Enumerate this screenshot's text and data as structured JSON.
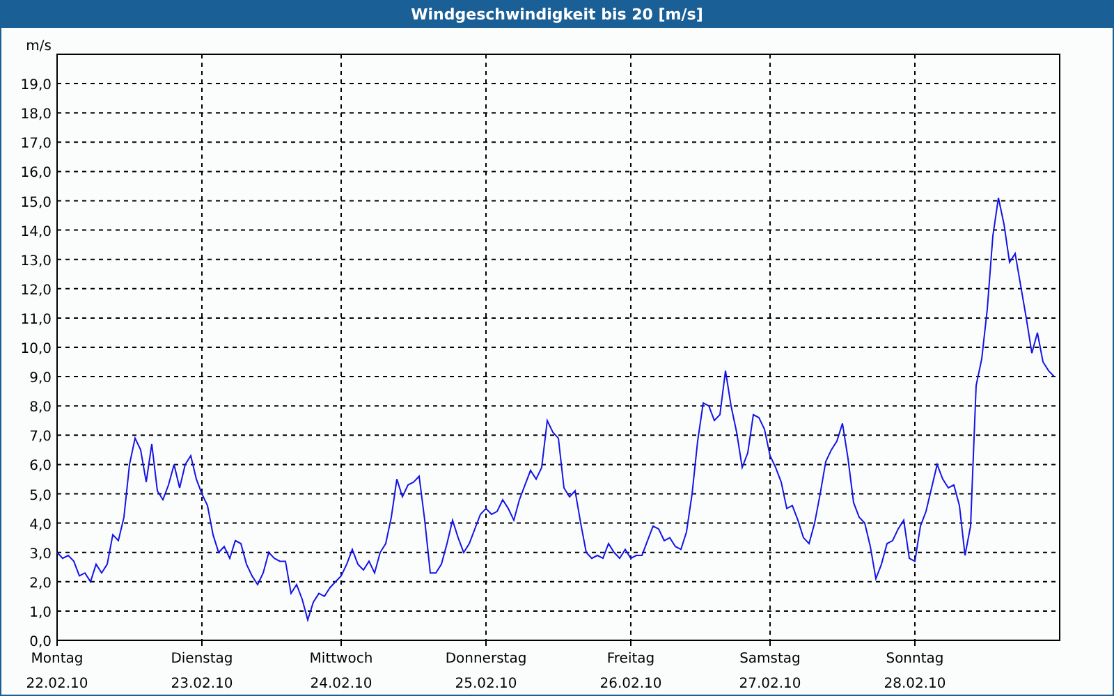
{
  "window": {
    "title": "Windgeschwindigkeit bis 20 [m/s]"
  },
  "chart": {
    "date_labels": [
      "22.02.10",
      "23.02.10",
      "24.02.10",
      "25.02.10",
      "26.02.10",
      "27.02.10",
      "28.02.10"
    ],
    "chart_data": {
      "type": "line",
      "ylabel": "m/s",
      "grid": true,
      "ylim": [
        0,
        20
      ],
      "yticks": [
        {
          "value": 0,
          "label": "0,0"
        },
        {
          "value": 1,
          "label": "1,0"
        },
        {
          "value": 2,
          "label": "2,0"
        },
        {
          "value": 3,
          "label": "3,0"
        },
        {
          "value": 4,
          "label": "4,0"
        },
        {
          "value": 5,
          "label": "5,0"
        },
        {
          "value": 6,
          "label": "6,0"
        },
        {
          "value": 7,
          "label": "7,0"
        },
        {
          "value": 8,
          "label": "8,0"
        },
        {
          "value": 9,
          "label": "9,0"
        },
        {
          "value": 10,
          "label": "10,0"
        },
        {
          "value": 11,
          "label": "11,0"
        },
        {
          "value": 12,
          "label": "12,0"
        },
        {
          "value": 13,
          "label": "13,0"
        },
        {
          "value": 14,
          "label": "14,0"
        },
        {
          "value": 15,
          "label": "15,0"
        },
        {
          "value": 16,
          "label": "16,0"
        },
        {
          "value": 17,
          "label": "17,0"
        },
        {
          "value": 18,
          "label": "18,0"
        },
        {
          "value": 19,
          "label": "19,0"
        }
      ],
      "categories": [
        "Montag",
        null,
        null,
        null,
        null,
        null,
        null,
        null,
        null,
        null,
        null,
        null,
        null,
        null,
        null,
        null,
        null,
        null,
        null,
        null,
        null,
        null,
        null,
        null,
        null,
        null,
        "Dienstag",
        null,
        null,
        null,
        null,
        null,
        null,
        null,
        null,
        null,
        null,
        null,
        null,
        null,
        null,
        null,
        null,
        null,
        null,
        null,
        null,
        null,
        null,
        null,
        null,
        "Mittwoch",
        null,
        null,
        null,
        null,
        null,
        null,
        null,
        null,
        null,
        null,
        null,
        null,
        null,
        null,
        null,
        null,
        null,
        null,
        null,
        null,
        null,
        null,
        null,
        null,
        null,
        "Donnerstag",
        null,
        null,
        null,
        null,
        null,
        null,
        null,
        null,
        null,
        null,
        null,
        null,
        null,
        null,
        null,
        null,
        null,
        null,
        null,
        null,
        null,
        null,
        null,
        null,
        null,
        "Freitag",
        null,
        null,
        null,
        null,
        null,
        null,
        null,
        null,
        null,
        null,
        null,
        null,
        null,
        null,
        null,
        null,
        null,
        null,
        null,
        null,
        null,
        null,
        null,
        null,
        "Samstag",
        null,
        null,
        null,
        null,
        null,
        null,
        null,
        null,
        null,
        null,
        null,
        null,
        null,
        null,
        null,
        null,
        null,
        null,
        null,
        null,
        null,
        null,
        null,
        null,
        null,
        "Sonntag",
        null,
        null,
        null,
        null,
        null,
        null,
        null,
        null,
        null,
        null,
        null,
        null,
        null,
        null,
        null,
        null,
        null,
        null,
        null,
        null,
        null,
        null,
        null,
        null,
        null
      ],
      "series": [
        {
          "color": "#1414e6",
          "values": [
            3.0,
            2.8,
            2.9,
            2.7,
            2.2,
            2.3,
            2.0,
            2.6,
            2.3,
            2.6,
            3.6,
            3.4,
            4.2,
            6.0,
            6.9,
            6.5,
            5.4,
            6.7,
            5.1,
            4.8,
            5.3,
            6.0,
            5.2,
            6.0,
            6.3,
            5.5,
            5.0,
            4.6,
            3.6,
            3.0,
            3.2,
            2.8,
            3.4,
            3.3,
            2.6,
            2.2,
            1.9,
            2.3,
            3.0,
            2.8,
            2.7,
            2.7,
            1.6,
            1.9,
            1.4,
            0.7,
            1.3,
            1.6,
            1.5,
            1.8,
            2.0,
            2.2,
            2.6,
            3.1,
            2.6,
            2.4,
            2.7,
            2.3,
            3.0,
            3.3,
            4.2,
            5.5,
            4.9,
            5.3,
            5.4,
            5.6,
            4.1,
            2.3,
            2.3,
            2.6,
            3.3,
            4.1,
            3.5,
            3.0,
            3.3,
            3.8,
            4.3,
            4.5,
            4.3,
            4.4,
            4.8,
            4.5,
            4.1,
            4.8,
            5.3,
            5.8,
            5.5,
            5.9,
            7.5,
            7.1,
            6.9,
            5.2,
            4.9,
            5.1,
            4.0,
            3.0,
            2.8,
            2.9,
            2.8,
            3.3,
            3.0,
            2.8,
            3.1,
            2.8,
            2.9,
            2.9,
            3.4,
            3.9,
            3.8,
            3.4,
            3.5,
            3.2,
            3.1,
            3.7,
            5.0,
            6.8,
            8.1,
            8.0,
            7.5,
            7.7,
            9.2,
            8.0,
            7.1,
            5.9,
            6.4,
            7.7,
            7.6,
            7.2,
            6.3,
            5.9,
            5.4,
            4.5,
            4.6,
            4.1,
            3.5,
            3.3,
            4.0,
            5.0,
            6.1,
            6.5,
            6.8,
            7.4,
            6.2,
            4.7,
            4.2,
            4.0,
            3.2,
            2.1,
            2.6,
            3.3,
            3.4,
            3.8,
            4.1,
            2.8,
            2.7,
            3.9,
            4.4,
            5.2,
            6.0,
            5.5,
            5.2,
            5.3,
            4.6,
            2.9,
            3.9,
            8.7,
            9.6,
            11.3,
            13.8,
            15.1,
            14.2,
            12.9,
            13.2,
            12.1,
            11.0,
            9.8,
            10.5,
            9.5,
            9.2,
            9.0
          ]
        }
      ]
    }
  }
}
